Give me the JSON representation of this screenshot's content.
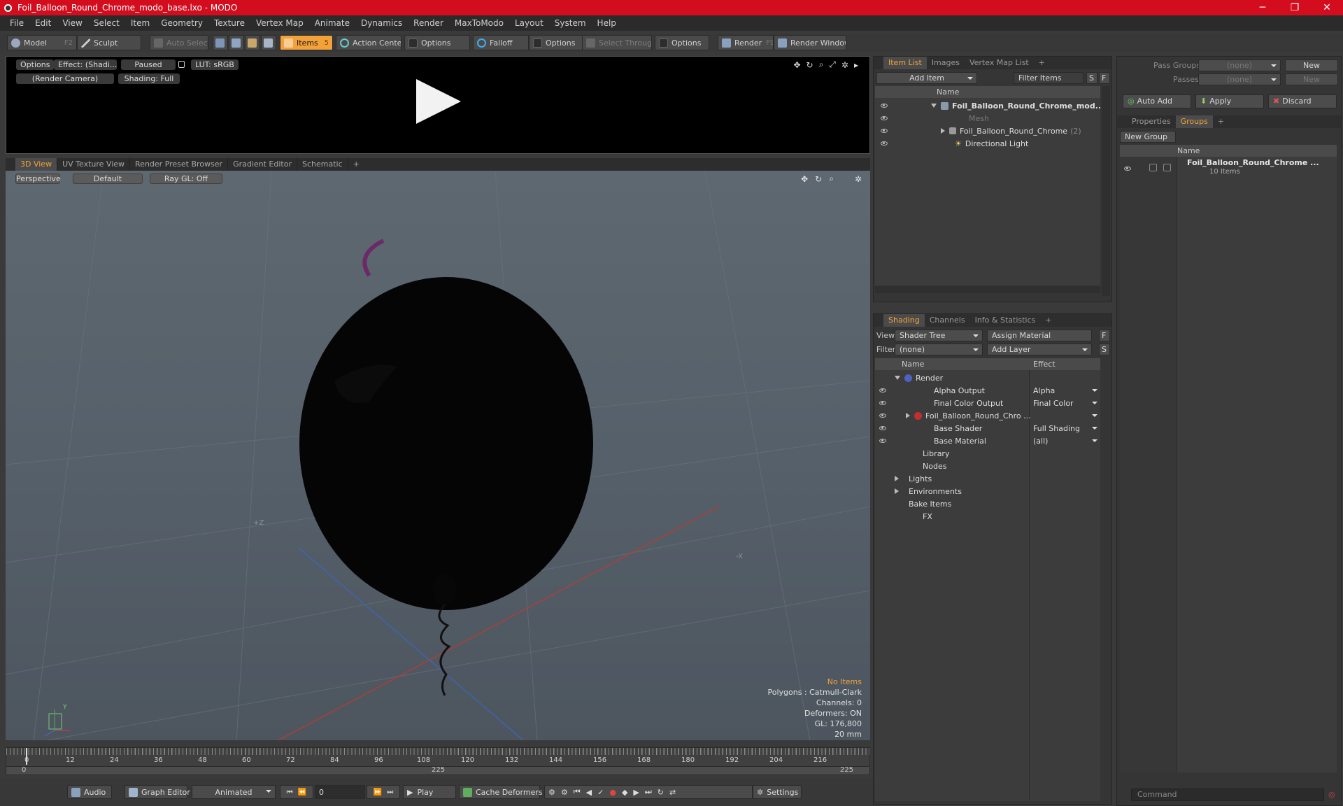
{
  "window": {
    "title": "Foil_Balloon_Round_Chrome_modo_base.lxo - MODO",
    "min": "─",
    "max": "❐",
    "close": "✕"
  },
  "menu": [
    "File",
    "Edit",
    "View",
    "Select",
    "Item",
    "Geometry",
    "Texture",
    "Vertex Map",
    "Animate",
    "Dynamics",
    "Render",
    "MaxToModo",
    "Layout",
    "System",
    "Help"
  ],
  "toolbar": {
    "model": "Model",
    "model_key": "F2",
    "sculpt": "Sculpt",
    "auto_select": "Auto Select",
    "items": "Items",
    "items_key": "5",
    "action_center": "Action Center",
    "options1": "Options",
    "falloff": "Falloff",
    "options2": "Options",
    "select_through": "Select Through",
    "options3": "Options",
    "render": "Render",
    "render_key": "F9",
    "render_window": "Render Window"
  },
  "preview": {
    "options": "Options",
    "effect": "Effect: (Shadi...",
    "paused": "Paused",
    "lut": "LUT: sRGB",
    "camera": "(Render Camera)",
    "shading": "Shading: Full"
  },
  "viewport_tabs": [
    "3D View",
    "UV Texture View",
    "Render Preset Browser",
    "Gradient Editor",
    "Schematic",
    "+"
  ],
  "viewport": {
    "perspective": "Perspective",
    "default": "Default",
    "raygl": "Ray GL: Off",
    "axis_z": "+Z",
    "axis_x": "-X",
    "axis_y": "Y",
    "info": {
      "items": "No Items",
      "polygons": "Polygons : Catmull-Clark",
      "channels": "Channels: 0",
      "deformers": "Deformers: ON",
      "gl": "GL: 176,800",
      "scale": "20 mm"
    }
  },
  "timeline": {
    "ticks": [
      "0",
      "12",
      "24",
      "36",
      "48",
      "60",
      "72",
      "84",
      "96",
      "108",
      "120",
      "132",
      "144",
      "156",
      "168",
      "180",
      "192",
      "204",
      "216"
    ],
    "start": "0",
    "mid": "225",
    "end": "225"
  },
  "bottombar": {
    "audio": "Audio",
    "graph_editor": "Graph Editor",
    "animated": "Animated",
    "frame": "0",
    "play": "Play",
    "cache": "Cache Deformers",
    "settings": "Settings"
  },
  "item_list": {
    "tabs": [
      "Item List",
      "Images",
      "Vertex Map List",
      "+"
    ],
    "add_item": "Add Item",
    "filter": "Filter Items",
    "s": "S",
    "f": "F",
    "col_name": "Name",
    "rows": [
      {
        "label": "Foil_Balloon_Round_Chrome_mod..."
      },
      {
        "label": "Mesh"
      },
      {
        "label": "Foil_Balloon_Round_Chrome",
        "count": "(2)"
      },
      {
        "label": "Directional Light"
      }
    ]
  },
  "shading": {
    "tabs": [
      "Shading",
      "Channels",
      "Info & Statistics",
      "+"
    ],
    "view_label": "View",
    "view_value": "Shader Tree",
    "assign": "Assign Material",
    "filter_label": "Filter",
    "filter_value": "(none)",
    "add_layer": "Add Layer",
    "f": "F",
    "s": "S",
    "col_name": "Name",
    "col_effect": "Effect",
    "rows": [
      {
        "name": "Render",
        "effect": ""
      },
      {
        "name": "Alpha Output",
        "effect": "Alpha"
      },
      {
        "name": "Final Color Output",
        "effect": "Final Color"
      },
      {
        "name": "Foil_Balloon_Round_Chro ...",
        "effect": ""
      },
      {
        "name": "Base Shader",
        "effect": "Full Shading"
      },
      {
        "name": "Base Material",
        "effect": "(all)"
      },
      {
        "name": "Library",
        "effect": ""
      },
      {
        "name": "Nodes",
        "effect": ""
      },
      {
        "name": "Lights",
        "effect": ""
      },
      {
        "name": "Environments",
        "effect": ""
      },
      {
        "name": "Bake Items",
        "effect": ""
      },
      {
        "name": "FX",
        "effect": ""
      }
    ]
  },
  "groups": {
    "pass_groups": "Pass Groups",
    "passes": "Passes",
    "none": "(none)",
    "new": "New",
    "auto_add": "Auto Add",
    "apply": "Apply",
    "discard": "Discard",
    "tabs": [
      "Properties",
      "Groups",
      "+"
    ],
    "new_group": "New Group",
    "col_name": "Name",
    "group_name": "Foil_Balloon_Round_Chrome ...",
    "group_items": "10 Items"
  },
  "command": {
    "placeholder": "Command"
  },
  "colors": {
    "accent": "#f3a23a",
    "titlebar": "#d30d1e"
  }
}
